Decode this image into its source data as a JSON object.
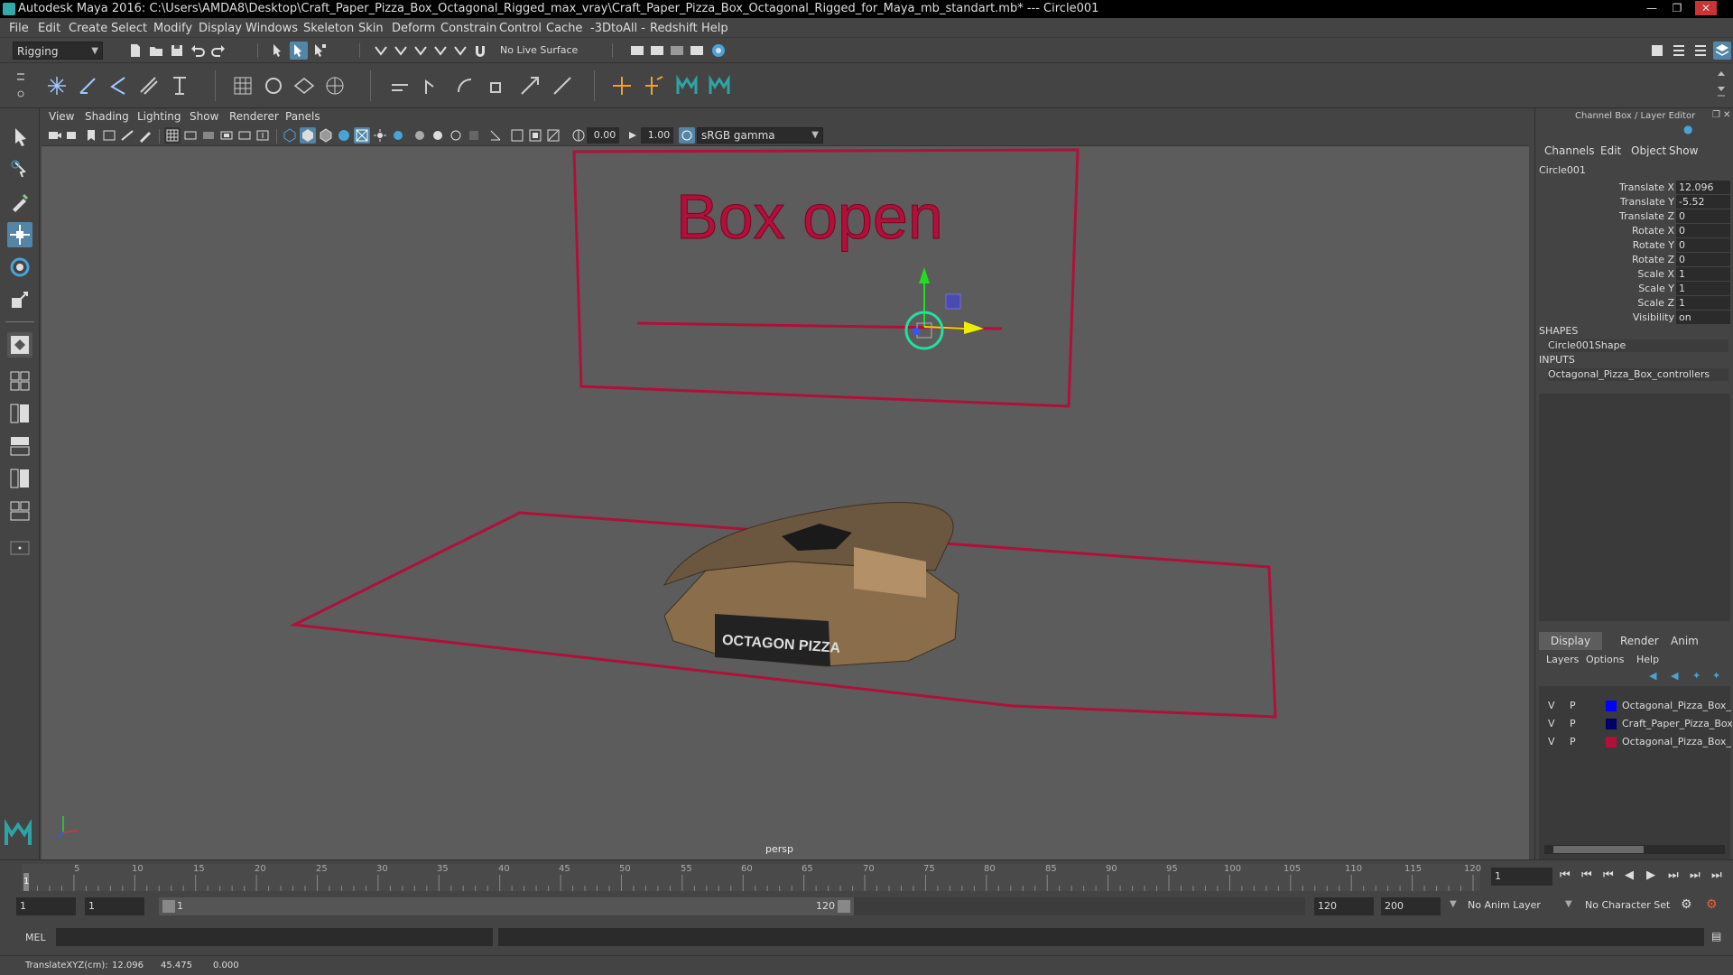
{
  "window": {
    "title": "Autodesk Maya 2016: C:\\Users\\AMDA8\\Desktop\\Craft_Paper_Pizza_Box_Octagonal_Rigged_max_vray\\Craft_Paper_Pizza_Box_Octagonal_Rigged_for_Maya_mb_standart.mb*   ---   Circle001"
  },
  "menu": [
    "File",
    "Edit",
    "Create",
    "Select",
    "Modify",
    "Display",
    "Windows",
    "Skeleton",
    "Skin",
    "Deform",
    "Constrain",
    "Control",
    "Cache",
    "-3DtoAll -",
    "Redshift",
    "Help"
  ],
  "statusline": {
    "mode": "Rigging",
    "live_surface": "No Live Surface"
  },
  "viewport": {
    "menu": [
      "View",
      "Shading",
      "Lighting",
      "Show",
      "Renderer",
      "Panels"
    ],
    "exposure": "0.00",
    "gamma": "1.00",
    "colorspace": "sRGB gamma",
    "camera_label": "persp",
    "scene_text": "Box open",
    "box_label": "OCTAGON PIZZA"
  },
  "channelbox": {
    "header": "Channel Box / Layer Editor",
    "menu": [
      "Channels",
      "Edit",
      "Object",
      "Show"
    ],
    "object": "Circle001",
    "channels": [
      {
        "label": "Translate X",
        "value": "12.096"
      },
      {
        "label": "Translate Y",
        "value": "-5.52"
      },
      {
        "label": "Translate Z",
        "value": "0"
      },
      {
        "label": "Rotate X",
        "value": "0"
      },
      {
        "label": "Rotate Y",
        "value": "0"
      },
      {
        "label": "Rotate Z",
        "value": "0"
      },
      {
        "label": "Scale X",
        "value": "1"
      },
      {
        "label": "Scale Y",
        "value": "1"
      },
      {
        "label": "Scale Z",
        "value": "1"
      },
      {
        "label": "Visibility",
        "value": "on"
      }
    ],
    "shapes_header": "SHAPES",
    "shape": "Circle001Shape",
    "inputs_header": "INPUTS",
    "input": "Octagonal_Pizza_Box_controllers"
  },
  "layers": {
    "tabs": [
      "Display",
      "Render",
      "Anim"
    ],
    "menu": [
      "Layers",
      "Options",
      "Help"
    ],
    "rows": [
      {
        "v": "V",
        "p": "P",
        "color": "#0000ff",
        "name": "Octagonal_Pizza_Box_"
      },
      {
        "v": "V",
        "p": "P",
        "color": "#00006a",
        "name": "Craft_Paper_Pizza_Box"
      },
      {
        "v": "V",
        "p": "P",
        "color": "#b0103a",
        "name": "Octagonal_Pizza_Box_"
      }
    ]
  },
  "timeline": {
    "ticks": [
      "5",
      "10",
      "15",
      "20",
      "25",
      "30",
      "35",
      "40",
      "45",
      "50",
      "55",
      "60",
      "65",
      "70",
      "75",
      "80",
      "85",
      "90",
      "95",
      "100",
      "105",
      "110",
      "115",
      "120"
    ],
    "current_frame": "1",
    "current_frame_marker": "1"
  },
  "range": {
    "start": "1",
    "playback_start": "1",
    "slider_start": "1",
    "slider_end": "120",
    "playback_end": "120",
    "end": "200",
    "anim_layer": "No Anim Layer",
    "character_set": "No Character Set"
  },
  "cmdline": {
    "label": "MEL"
  },
  "helpline": {
    "label": "TranslateXYZ(cm):",
    "x": "12.096",
    "y": "45.475",
    "z": "0.000"
  }
}
